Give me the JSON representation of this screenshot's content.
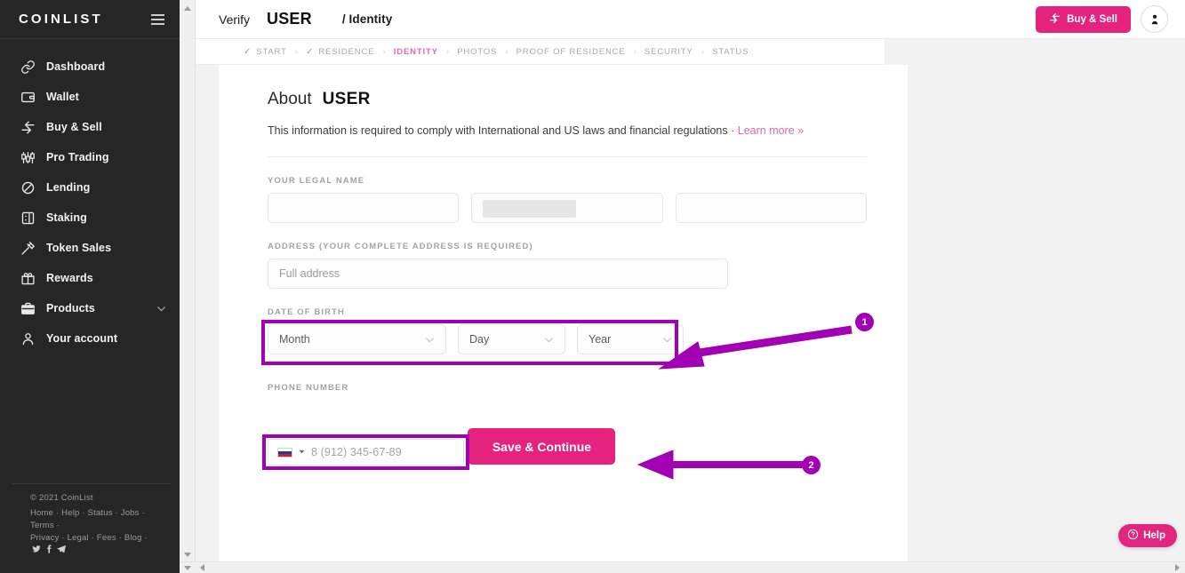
{
  "sidebar": {
    "logo": "COINLIST",
    "menu_icon": "hamburger-icon",
    "items": [
      {
        "label": "Dashboard",
        "icon": "link-icon"
      },
      {
        "label": "Wallet",
        "icon": "wallet-icon"
      },
      {
        "label": "Buy & Sell",
        "icon": "arrows-icon"
      },
      {
        "label": "Pro Trading",
        "icon": "candlestick-icon"
      },
      {
        "label": "Lending",
        "icon": "lending-icon"
      },
      {
        "label": "Staking",
        "icon": "staking-icon"
      },
      {
        "label": "Token Sales",
        "icon": "gavel-icon"
      },
      {
        "label": "Rewards",
        "icon": "gift-icon"
      },
      {
        "label": "Products",
        "icon": "briefcase-icon",
        "expandable": true
      },
      {
        "label": "Your account",
        "icon": "person-icon"
      }
    ],
    "footer": {
      "copyright": "© 2021 CoinList",
      "links_line1": "Home · Help · Status · Jobs · Terms ·",
      "links_line2": "Privacy · Legal · Fees · Blog ·"
    }
  },
  "topbar": {
    "verify_label": "Verify",
    "user_label": "USER",
    "section_label": "/ Identity",
    "buy_sell_label": "Buy & Sell",
    "avatar": "account-avatar"
  },
  "steps": [
    {
      "label": "START",
      "state": "done"
    },
    {
      "label": "RESIDENCE",
      "state": "done"
    },
    {
      "label": "IDENTITY",
      "state": "active"
    },
    {
      "label": "PHOTOS",
      "state": "todo"
    },
    {
      "label": "PROOF OF RESIDENCE",
      "state": "todo"
    },
    {
      "label": "SECURITY",
      "state": "todo"
    },
    {
      "label": "STATUS",
      "state": "todo"
    }
  ],
  "form": {
    "about_label": "About",
    "about_user": "USER",
    "description": "This information is required to comply with International and US laws and financial regulations ·",
    "learn_more": "Learn more »",
    "legal_name_label": "YOUR LEGAL NAME",
    "legal_name_values": [
      "",
      "",
      ""
    ],
    "address_label": "ADDRESS (YOUR COMPLETE ADDRESS IS REQUIRED)",
    "address_placeholder": "Full address",
    "address_value": "",
    "dob_label": "DATE OF BIRTH",
    "dob_month": "Month",
    "dob_day": "Day",
    "dob_year": "Year",
    "phone_label": "PHONE NUMBER",
    "phone_country": "RU",
    "phone_placeholder": "8 (912) 345-67-89",
    "phone_value": "",
    "save_label": "Save & Continue"
  },
  "annotations": [
    {
      "id": "1",
      "target": "date-of-birth-field"
    },
    {
      "id": "2",
      "target": "phone-number-field"
    }
  ],
  "help": {
    "label": "Help",
    "icon": "question-circle-icon"
  },
  "colors": {
    "brand_pink": "#e5237e",
    "sidebar_bg": "#262626",
    "annotation_purple": "#a200b5",
    "active_step": "#e56aa4"
  }
}
